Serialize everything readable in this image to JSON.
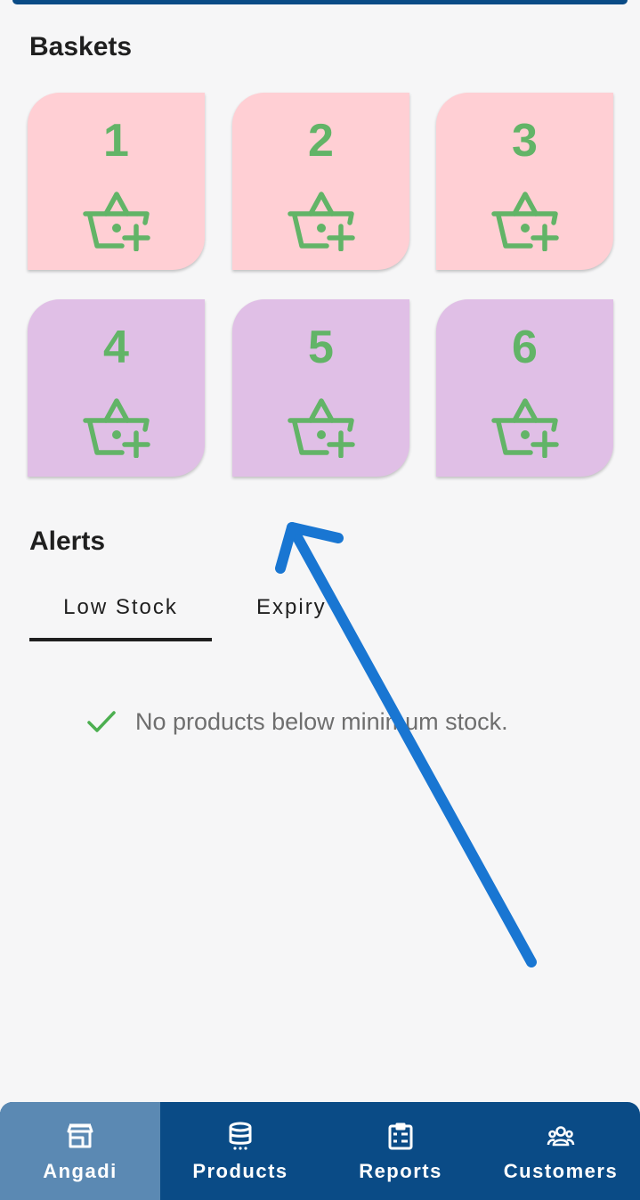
{
  "baskets": {
    "title": "Baskets",
    "items": [
      {
        "number": "1",
        "color": "#ffcfd4"
      },
      {
        "number": "2",
        "color": "#ffcfd4"
      },
      {
        "number": "3",
        "color": "#ffcfd4"
      },
      {
        "number": "4",
        "color": "#e0bfe6"
      },
      {
        "number": "5",
        "color": "#e0bfe6"
      },
      {
        "number": "6",
        "color": "#e0bfe6"
      }
    ],
    "icon": "basket-add-icon",
    "accent": "#62b467"
  },
  "alerts": {
    "title": "Alerts",
    "tabs": [
      {
        "label": "Low Stock",
        "selected": true
      },
      {
        "label": "Expiry",
        "selected": false
      }
    ],
    "empty_message": "No products below minimum stock.",
    "empty_icon": "check-icon"
  },
  "bottom_nav": {
    "background": "#0a4b86",
    "active_background": "#5b89b3",
    "items": [
      {
        "label": "Angadi",
        "icon": "store-icon",
        "active": true
      },
      {
        "label": "Products",
        "icon": "database-icon",
        "active": false
      },
      {
        "label": "Reports",
        "icon": "clipboard-list-icon",
        "active": false
      },
      {
        "label": "Customers",
        "icon": "group-icon",
        "active": false
      }
    ]
  }
}
